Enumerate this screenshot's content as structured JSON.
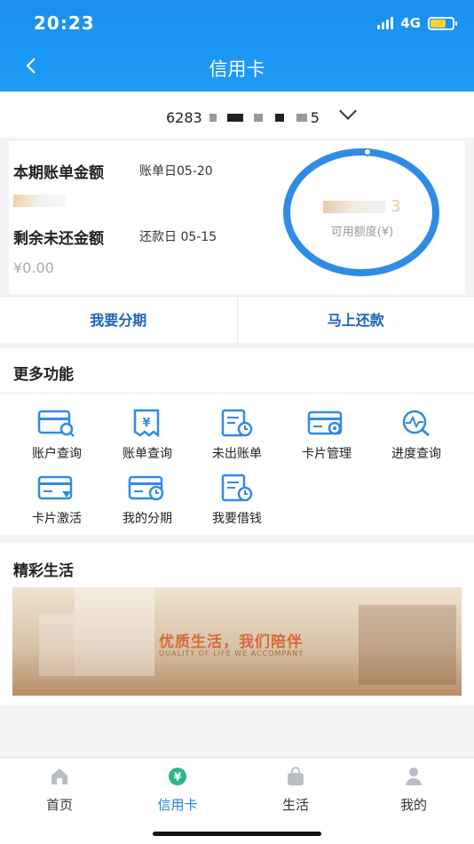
{
  "status": {
    "time": "20:23",
    "network": "4G"
  },
  "header": {
    "title": "信用卡",
    "back_icon": "chevron-left-icon"
  },
  "card": {
    "number_prefix": "6283",
    "number_suffix": "5"
  },
  "bill": {
    "current_label": "本期账单金额",
    "bill_day": "账单日05-20",
    "remaining_label": "剩余未还金额",
    "repay_day": "还款日 05-15",
    "remaining_value": "¥0.00"
  },
  "credit": {
    "available_label": "可用额度(¥)",
    "available_suffix": "3"
  },
  "actions": {
    "installment": "我要分期",
    "repay_now": "马上还款"
  },
  "more": {
    "title": "更多功能",
    "items": [
      {
        "label": "账户查询",
        "icon": "card-search-icon"
      },
      {
        "label": "账单查询",
        "icon": "bill-yen-icon"
      },
      {
        "label": "未出账单",
        "icon": "bill-clock-icon"
      },
      {
        "label": "卡片管理",
        "icon": "card-gear-icon"
      },
      {
        "label": "进度查询",
        "icon": "progress-search-icon"
      },
      {
        "label": "卡片激活",
        "icon": "card-activate-icon"
      },
      {
        "label": "我的分期",
        "icon": "card-clock-icon"
      },
      {
        "label": "我要借钱",
        "icon": "loan-document-icon"
      }
    ]
  },
  "life": {
    "title": "精彩生活",
    "banner_text": "优质生活，我们陪伴",
    "banner_sub": "QUALITY OF LIFE WE ACCOMPANY"
  },
  "tabs": [
    {
      "label": "首页",
      "icon": "home-icon",
      "active": false
    },
    {
      "label": "信用卡",
      "icon": "yen-coin-icon",
      "active": true
    },
    {
      "label": "生活",
      "icon": "bag-icon",
      "active": false
    },
    {
      "label": "我的",
      "icon": "user-icon",
      "active": false
    }
  ],
  "colors": {
    "primary": "#1e8ff2",
    "accent_text": "#1d64b9"
  }
}
